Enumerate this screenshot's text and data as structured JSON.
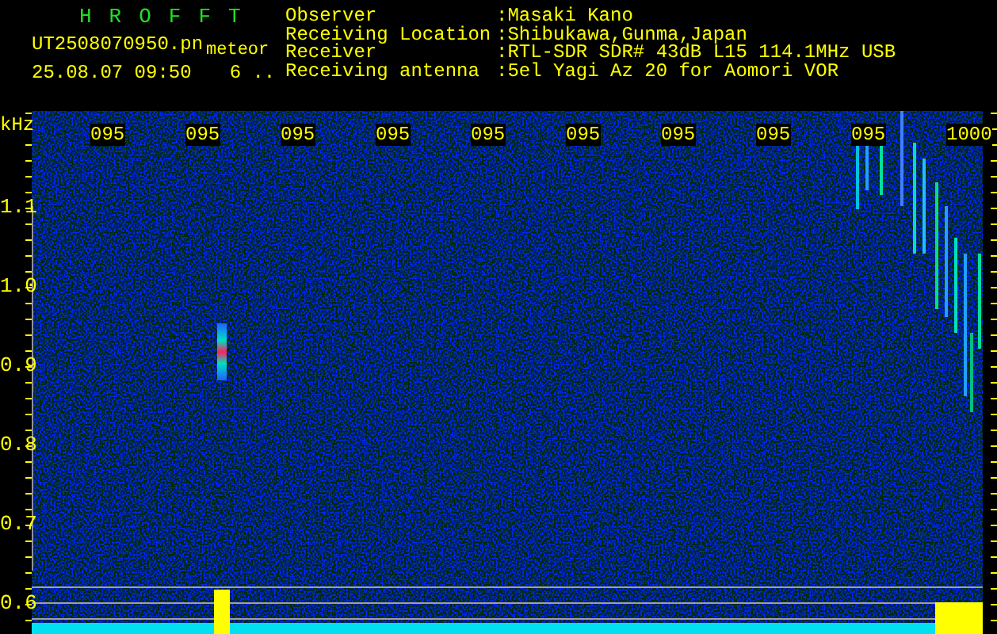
{
  "header": {
    "title": "HROFFT",
    "file_name": "UT2508070950.pn",
    "mode": "meteor",
    "timestamp": "25.08.07 09:50",
    "count": "6 ..",
    "fields": [
      {
        "label": "Observer",
        "value": ":Masaki Kano"
      },
      {
        "label": "Receiving Location",
        "value": ":Shibukawa,Gunma,Japan"
      },
      {
        "label": "Receiver",
        "value": ":RTL-SDR SDR# 43dB L15 114.1MHz USB"
      },
      {
        "label": "Receiving antenna",
        "value": ":5el Yagi Az 20 for Aomori VOR"
      }
    ]
  },
  "plot": {
    "y_unit": "kHz",
    "y_labels": [
      "1.1",
      "1.0",
      "0.9",
      "0.8",
      "0.7",
      "0.6"
    ],
    "x_labels": [
      "095",
      "095",
      "095",
      "095",
      "095",
      "095",
      "095",
      "095",
      "095",
      "1000"
    ]
  }
}
